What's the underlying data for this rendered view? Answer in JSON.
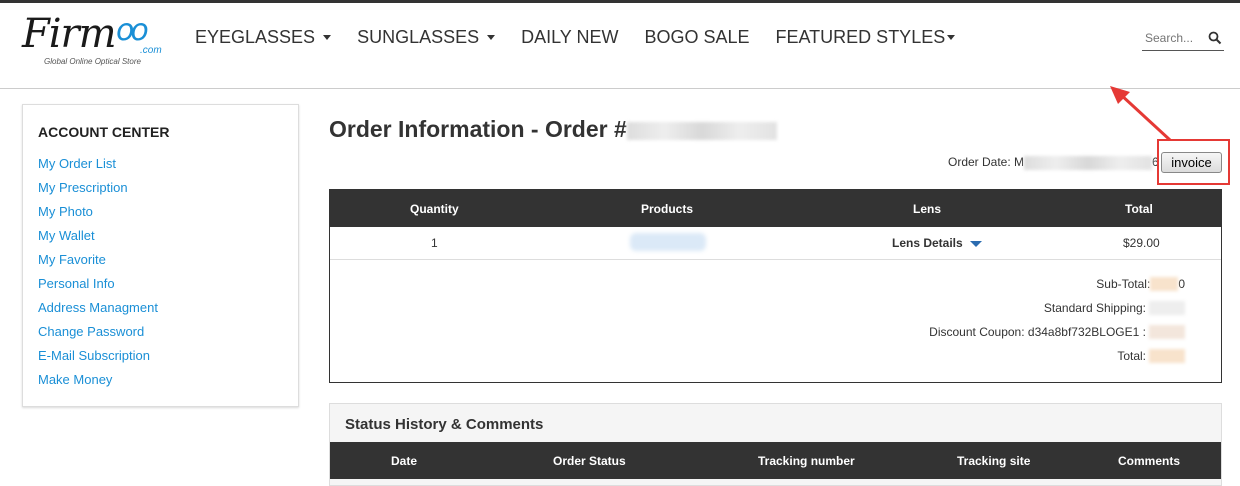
{
  "brand": {
    "logo_main": "Firm",
    "logo_oo": "oo",
    "logo_com": ".com",
    "tagline": "Global Online Optical Store"
  },
  "nav": {
    "items": [
      {
        "label": "EYEGLASSES",
        "dropdown": true
      },
      {
        "label": "SUNGLASSES",
        "dropdown": true
      },
      {
        "label": "DAILY NEW",
        "dropdown": false
      },
      {
        "label": "BOGO SALE",
        "dropdown": false
      },
      {
        "label": "FEATURED STYLES",
        "dropdown": true
      }
    ]
  },
  "search": {
    "placeholder": "Search...",
    "icon": "search-icon"
  },
  "sidebar": {
    "title": "ACCOUNT CENTER",
    "links": [
      "My Order List",
      "My Prescription",
      "My Photo",
      "My Wallet",
      "My Favorite",
      "Personal Info",
      "Address Managment",
      "Change Password",
      "E-Mail Subscription",
      "Make Money"
    ]
  },
  "order": {
    "title": "Order Information - Order #",
    "date_label": "Order Date: ",
    "date_partial_start": "M",
    "date_partial_end": "6",
    "invoice_label": "invoice"
  },
  "order_table": {
    "headers": [
      "Quantity",
      "Products",
      "Lens",
      "Total"
    ],
    "row": {
      "quantity": "1",
      "lens_details_label": "Lens Details",
      "total": "$29.00"
    },
    "totals": {
      "subtotal_label": "Sub-Total: ",
      "subtotal_tail": "0",
      "shipping_label": "Standard Shipping: ",
      "coupon_label": "Discount Coupon: d34a8bf732BLOGE1 : ",
      "total_label": "Total: "
    }
  },
  "status_history": {
    "title": "Status History & Comments",
    "headers": [
      "Date",
      "Order Status",
      "Tracking number",
      "Tracking site",
      "Comments"
    ]
  },
  "colors": {
    "link": "#1a8fd6",
    "table_header_bg": "#333333",
    "annotation_red": "#e53935",
    "lens_caret": "#2b6cb0"
  }
}
